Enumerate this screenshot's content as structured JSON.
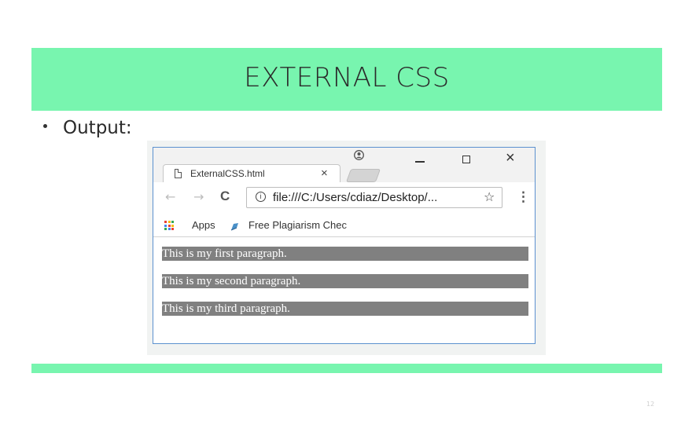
{
  "slide": {
    "title": "EXTERNAL CSS",
    "bullet": "Output:",
    "page_number": "12",
    "accent_color": "#78f5af"
  },
  "browser": {
    "tab": {
      "label": "ExternalCSS.html",
      "close": "×",
      "icon": "page-icon"
    },
    "window_controls": {
      "minimize": "minimize-icon",
      "maximize": "maximize-icon",
      "close": "×"
    },
    "nav": {
      "back": "←",
      "forward": "→",
      "reload": "C",
      "info": "i",
      "url": "file:///C:/Users/cdiaz/Desktop/...",
      "star": "☆",
      "menu": "⋮"
    },
    "bookmarks": [
      {
        "label": "Apps",
        "icon": "apps-grid-icon"
      },
      {
        "label": "Free Plagiarism Chec",
        "icon": "plagiarism-icon"
      }
    ]
  },
  "paragraphs": [
    "This is my first paragraph.",
    "This is my second paragraph.",
    "This is my third paragraph."
  ],
  "colors": {
    "paragraph_bg": "#808080",
    "paragraph_text": "#ffffff",
    "window_border": "#5c91cf"
  }
}
